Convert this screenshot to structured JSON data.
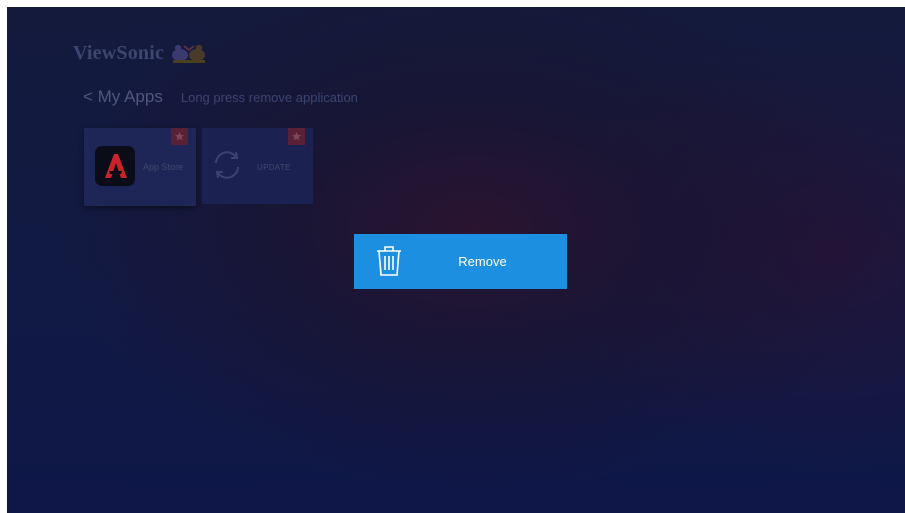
{
  "brand": {
    "logo_text": "ViewSonic",
    "mascot_icon": "viewsonic-birds-icon"
  },
  "header": {
    "back_title": "< My Apps",
    "hint": "Long press remove application"
  },
  "apps": [
    {
      "label": "App Store",
      "icon": "app-store-icon",
      "badge_icon": "star-icon",
      "selected": true
    },
    {
      "label": "UPDATE",
      "icon": "refresh-icon",
      "badge_icon": "star-icon",
      "selected": false
    }
  ],
  "dialog": {
    "remove_label": "Remove",
    "icon": "trash-icon"
  },
  "colors": {
    "accent": "#1d8fe0",
    "background": "#121a42",
    "badge": "#5a2035"
  }
}
